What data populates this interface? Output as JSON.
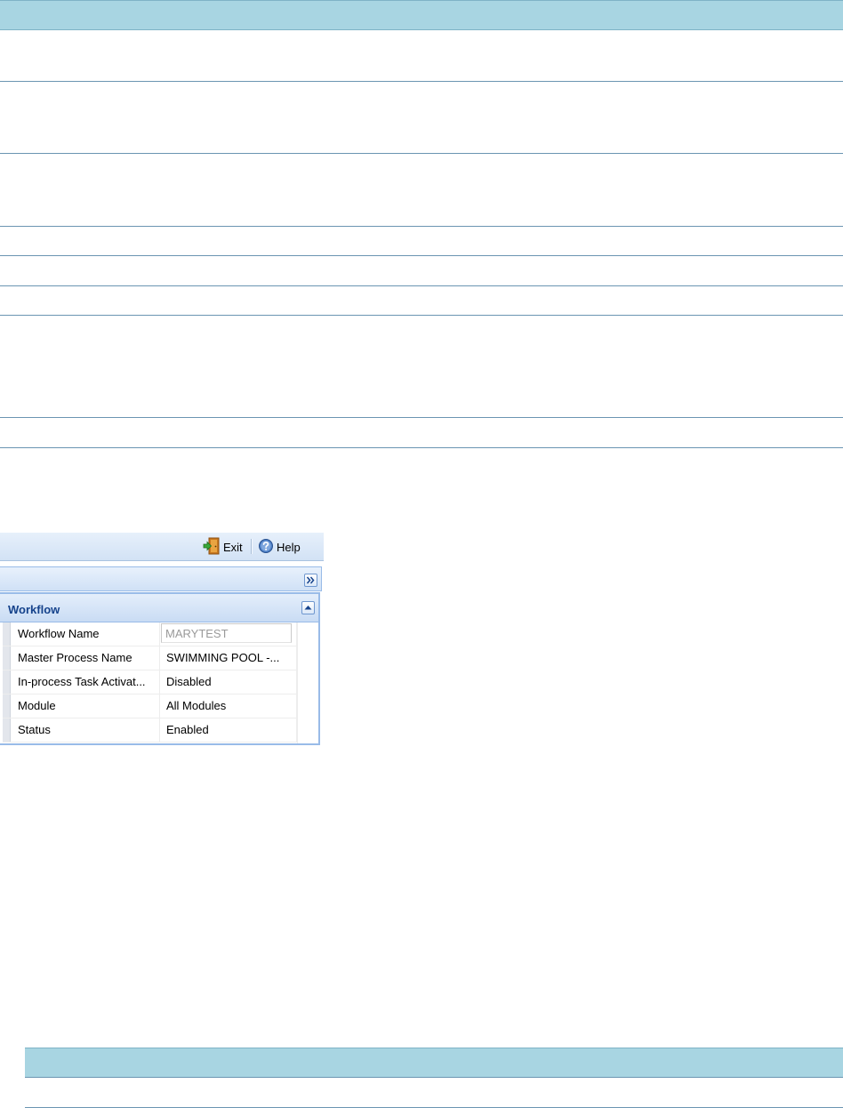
{
  "toolbar": {
    "exit_label": "Exit",
    "help_label": "Help"
  },
  "workflow_panel": {
    "title": "Workflow",
    "rows": [
      {
        "name": "Workflow Name",
        "value": "MARYTEST"
      },
      {
        "name": "Master Process Name",
        "value": "SWIMMING POOL -..."
      },
      {
        "name": "In-process Task Activat...",
        "value": "Disabled"
      },
      {
        "name": "Module",
        "value": "All Modules"
      },
      {
        "name": "Status",
        "value": "Enabled"
      }
    ]
  },
  "icons": {
    "exit": "exit-door-icon",
    "help": "help-icon",
    "expand": "double-chevron-right-icon",
    "collapse": "triangle-up-icon"
  },
  "colors": {
    "table_header": "#a8d5e2",
    "row_rule": "#6b95b2",
    "panel_title": "#15428b",
    "panel_border": "#99bbe8"
  }
}
